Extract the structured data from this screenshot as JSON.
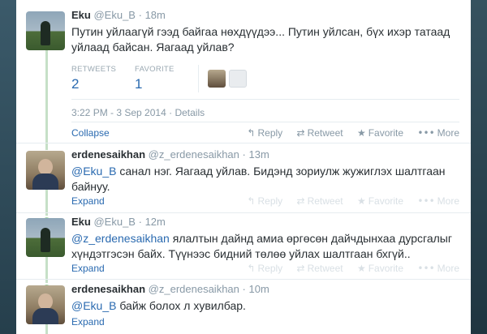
{
  "main_tweet": {
    "fullname": "Eku",
    "username": "@Eku_B",
    "time": "18m",
    "text": "Путин уйлаагүй гээд байгаа нөхдүүдээ... Путин уйлсан, бүх ихэр татаад уйлаад байсан. Яагаад уйлав?",
    "retweets_label": "RETWEETS",
    "retweets_value": "2",
    "favorites_label": "FAVORITE",
    "favorites_value": "1",
    "timestamp": "3:22 PM - 3 Sep 2014",
    "details_label": "Details",
    "collapse_label": "Collapse"
  },
  "actions": {
    "reply": "Reply",
    "retweet": "Retweet",
    "favorite": "Favorite",
    "more": "More"
  },
  "replies": [
    {
      "fullname": "erdenesaikhan",
      "username": "@z_erdenesaikhan",
      "time": "13m",
      "mention": "@Eku_B",
      "text": " санал нэг. Яагаад уйлав. Бидэнд зориулж жужиглэх шалтгаан байнуу.",
      "expand_label": "Expand"
    },
    {
      "fullname": "Eku",
      "username": "@Eku_B",
      "time": "12m",
      "mention": "@z_erdenesaikhan",
      "text": " ялалтын дайнд амиа өргөсөн дайчдынхаа дурсгалыг хүндэтгэсэн байх. Түүнээс бидний төлөө уйлах шалтгаан бхгүй..",
      "expand_label": "Expand"
    },
    {
      "fullname": "erdenesaikhan",
      "username": "@z_erdenesaikhan",
      "time": "10m",
      "mention": "@Eku_B",
      "text": " байж болох л хувилбар.",
      "expand_label": "Expand"
    }
  ],
  "icons": {
    "reply": "reply-arrow-icon",
    "retweet": "retweet-icon",
    "favorite": "star-icon",
    "more": "ellipsis-icon"
  },
  "colors": {
    "link": "#2a6ab0",
    "thread_line": "#9ed4a0",
    "background": "#2e4b5a"
  }
}
